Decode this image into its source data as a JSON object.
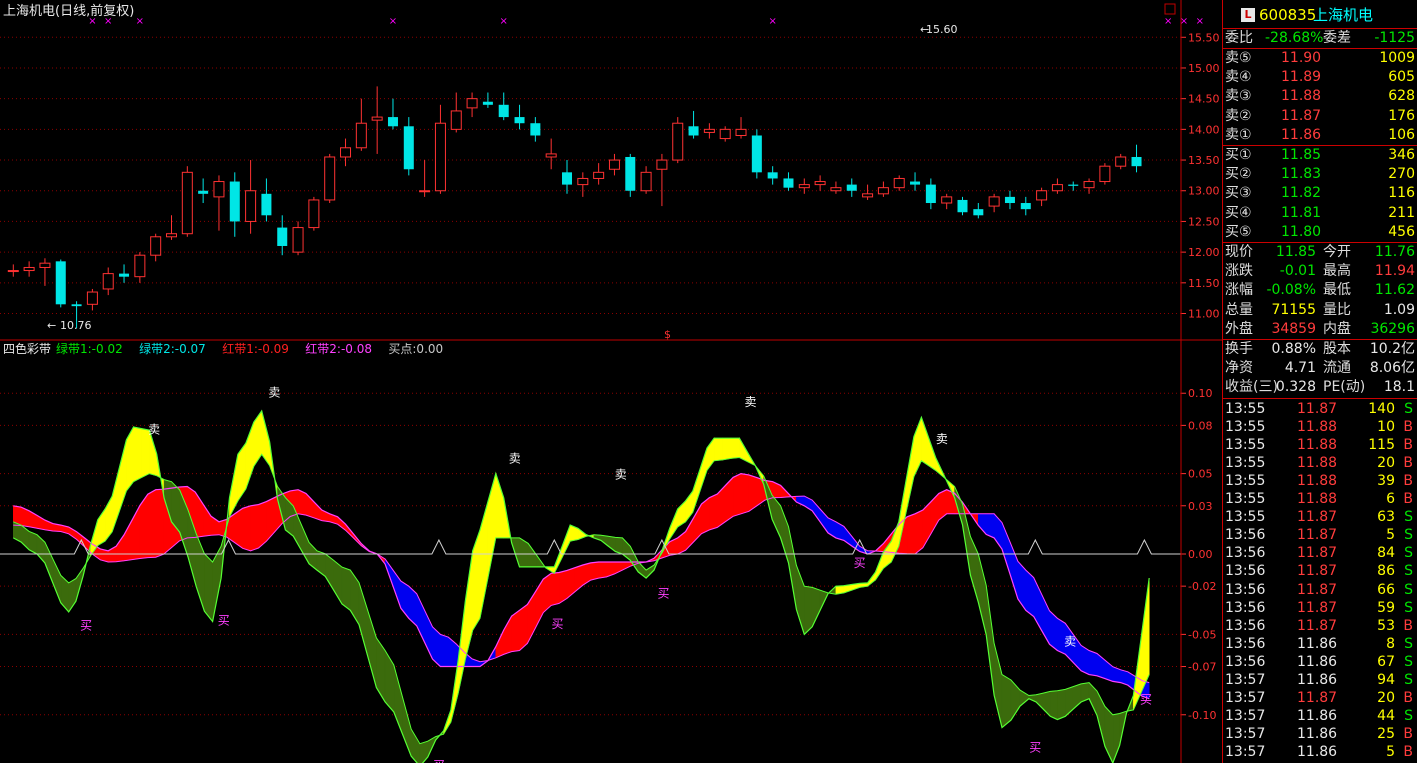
{
  "window": {
    "title": "上海机电(日线,前复权)",
    "peak_label": "15.60",
    "trough_label": "10.76",
    "dollar_marker": "$"
  },
  "indicator": {
    "name": "四色彩带",
    "legend": [
      {
        "text": "绿带1:-0.02",
        "color": "#00e600"
      },
      {
        "text": "绿带2:-0.07",
        "color": "#00e6e6"
      },
      {
        "text": "红带1:-0.09",
        "color": "#ff2020"
      },
      {
        "text": "红带2:-0.08",
        "color": "#ff40ff"
      },
      {
        "text": "买点:0.00",
        "color": "#c8c8c8"
      }
    ],
    "sell_label": "卖",
    "buy_label": "买"
  },
  "colors": {
    "up": "#ff3232",
    "down": "#00e6e6",
    "grid": "#8b0000",
    "axis": "#ff3232",
    "marker": "#ff00ff",
    "yellow_band": "#ffff00",
    "green_band": "#3b6b0c",
    "red_band": "#ff0000",
    "blue_band": "#0000f0"
  },
  "chart_data": [
    {
      "type": "candlestick",
      "ylim": [
        10.65,
        15.7
      ],
      "y_ticks": [
        "15.50",
        "15.00",
        "14.50",
        "14.00",
        "13.50",
        "13.00",
        "12.50",
        "12.00",
        "11.50",
        "11.00"
      ],
      "tick_values": [
        15.5,
        15.0,
        14.5,
        14.0,
        13.5,
        13.0,
        12.5,
        12.0,
        11.5,
        11.0
      ],
      "ohlc": [
        [
          11.7,
          11.8,
          11.6,
          11.7
        ],
        [
          11.7,
          11.85,
          11.6,
          11.75
        ],
        [
          11.75,
          11.9,
          11.45,
          11.82
        ],
        [
          11.85,
          11.88,
          11.1,
          11.15
        ],
        [
          11.15,
          11.2,
          10.76,
          11.12
        ],
        [
          11.15,
          11.4,
          11.05,
          11.35
        ],
        [
          11.4,
          11.75,
          11.3,
          11.65
        ],
        [
          11.65,
          11.8,
          11.5,
          11.6
        ],
        [
          11.6,
          12.0,
          11.5,
          11.95
        ],
        [
          11.95,
          12.3,
          11.85,
          12.25
        ],
        [
          12.25,
          12.6,
          12.2,
          12.3
        ],
        [
          12.3,
          13.4,
          12.25,
          13.3
        ],
        [
          13.0,
          13.2,
          12.8,
          12.95
        ],
        [
          12.9,
          13.25,
          12.35,
          13.15
        ],
        [
          13.15,
          13.3,
          12.25,
          12.5
        ],
        [
          12.5,
          13.5,
          12.3,
          13.0
        ],
        [
          12.95,
          13.2,
          12.5,
          12.6
        ],
        [
          12.4,
          12.6,
          11.95,
          12.1
        ],
        [
          12.0,
          12.5,
          11.95,
          12.4
        ],
        [
          12.4,
          12.9,
          12.35,
          12.85
        ],
        [
          12.85,
          13.6,
          12.8,
          13.55
        ],
        [
          13.55,
          13.85,
          13.4,
          13.7
        ],
        [
          13.7,
          14.5,
          13.65,
          14.1
        ],
        [
          14.15,
          14.7,
          13.6,
          14.2
        ],
        [
          14.2,
          14.5,
          14.0,
          14.05
        ],
        [
          14.05,
          14.2,
          13.25,
          13.35
        ],
        [
          13.0,
          13.5,
          12.9,
          13.0
        ],
        [
          13.0,
          14.4,
          12.95,
          14.1
        ],
        [
          14.0,
          14.6,
          13.95,
          14.3
        ],
        [
          14.35,
          14.6,
          14.2,
          14.5
        ],
        [
          14.45,
          14.6,
          14.35,
          14.4
        ],
        [
          14.4,
          14.6,
          14.15,
          14.2
        ],
        [
          14.2,
          14.4,
          14.0,
          14.1
        ],
        [
          14.1,
          14.2,
          13.8,
          13.9
        ],
        [
          13.55,
          13.85,
          13.35,
          13.6
        ],
        [
          13.3,
          13.5,
          12.95,
          13.1
        ],
        [
          13.1,
          13.3,
          12.9,
          13.2
        ],
        [
          13.2,
          13.45,
          13.1,
          13.3
        ],
        [
          13.35,
          13.6,
          13.25,
          13.5
        ],
        [
          13.55,
          13.6,
          12.9,
          13.0
        ],
        [
          13.0,
          13.4,
          12.95,
          13.3
        ],
        [
          13.35,
          13.6,
          12.75,
          13.5
        ],
        [
          13.5,
          14.2,
          13.45,
          14.1
        ],
        [
          14.05,
          14.3,
          13.85,
          13.9
        ],
        [
          13.95,
          14.1,
          13.85,
          14.0
        ],
        [
          13.85,
          14.05,
          13.8,
          14.0
        ],
        [
          13.9,
          14.2,
          13.85,
          14.0
        ],
        [
          13.9,
          14.0,
          13.2,
          13.3
        ],
        [
          13.3,
          13.4,
          13.1,
          13.2
        ],
        [
          13.2,
          13.3,
          13.0,
          13.05
        ],
        [
          13.05,
          13.2,
          12.95,
          13.1
        ],
        [
          13.1,
          13.25,
          13.0,
          13.15
        ],
        [
          13.0,
          13.15,
          12.95,
          13.05
        ],
        [
          13.1,
          13.2,
          12.9,
          13.0
        ],
        [
          12.9,
          13.1,
          12.85,
          12.95
        ],
        [
          12.95,
          13.15,
          12.9,
          13.05
        ],
        [
          13.05,
          13.25,
          13.0,
          13.2
        ],
        [
          13.15,
          13.3,
          13.0,
          13.1
        ],
        [
          13.1,
          13.2,
          12.7,
          12.8
        ],
        [
          12.8,
          12.95,
          12.7,
          12.9
        ],
        [
          12.85,
          12.9,
          12.6,
          12.65
        ],
        [
          12.7,
          12.8,
          12.55,
          12.6
        ],
        [
          12.75,
          12.95,
          12.65,
          12.9
        ],
        [
          12.9,
          13.0,
          12.7,
          12.8
        ],
        [
          12.8,
          12.9,
          12.6,
          12.7
        ],
        [
          12.85,
          13.05,
          12.75,
          13.0
        ],
        [
          13.0,
          13.2,
          12.95,
          13.1
        ],
        [
          13.1,
          13.15,
          13.0,
          13.08
        ],
        [
          13.05,
          13.2,
          12.95,
          13.15
        ],
        [
          13.15,
          13.45,
          13.1,
          13.4
        ],
        [
          13.4,
          13.6,
          13.35,
          13.55
        ],
        [
          13.55,
          13.75,
          13.3,
          13.4
        ]
      ],
      "markers_top_days": [
        5,
        6,
        8,
        24,
        31,
        48,
        73,
        74,
        75
      ]
    },
    {
      "type": "area",
      "ylim": [
        -0.13,
        0.13
      ],
      "y_ticks": [
        "0.10",
        "0.08",
        "0.05",
        "0.03",
        "0.00",
        "-0.02",
        "-0.05",
        "-0.07",
        "-0.10"
      ],
      "tick_values": [
        0.1,
        0.08,
        0.05,
        0.03,
        0.0,
        -0.02,
        -0.05,
        -0.07,
        -0.1
      ],
      "signals": [
        {
          "kind": "sell",
          "x": 8.9,
          "y": 0.075
        },
        {
          "kind": "sell",
          "x": 16.5,
          "y": 0.098
        },
        {
          "kind": "sell",
          "x": 31.7,
          "y": 0.057
        },
        {
          "kind": "sell",
          "x": 38.4,
          "y": 0.047
        },
        {
          "kind": "sell",
          "x": 46.6,
          "y": 0.092
        },
        {
          "kind": "sell",
          "x": 58.7,
          "y": 0.069
        },
        {
          "kind": "sell",
          "x": 66.8,
          "y": -0.057
        },
        {
          "kind": "buy",
          "x": 4.6,
          "y": -0.047
        },
        {
          "kind": "buy",
          "x": 13.3,
          "y": -0.044
        },
        {
          "kind": "buy",
          "x": 34.4,
          "y": -0.046
        },
        {
          "kind": "buy",
          "x": 41.1,
          "y": -0.027
        },
        {
          "kind": "buy",
          "x": 53.5,
          "y": -0.008
        },
        {
          "kind": "buy",
          "x": 26.9,
          "y": -0.134
        },
        {
          "kind": "buy",
          "x": 64.6,
          "y": -0.123
        },
        {
          "kind": "buy",
          "x": 71.6,
          "y": -0.093
        }
      ]
    }
  ],
  "panel": {
    "code_badge": "L",
    "code": "600835",
    "name": "上海机电",
    "weibi_label": "委比",
    "weibi": "-28.68%",
    "weicha_label": "委差",
    "weicha": "-1125",
    "asks": [
      {
        "label": "卖⑤",
        "price": "11.90",
        "vol": "1009"
      },
      {
        "label": "卖④",
        "price": "11.89",
        "vol": "605"
      },
      {
        "label": "卖③",
        "price": "11.88",
        "vol": "628"
      },
      {
        "label": "卖②",
        "price": "11.87",
        "vol": "176"
      },
      {
        "label": "卖①",
        "price": "11.86",
        "vol": "106"
      }
    ],
    "bids": [
      {
        "label": "买①",
        "price": "11.85",
        "vol": "346"
      },
      {
        "label": "买②",
        "price": "11.83",
        "vol": "270"
      },
      {
        "label": "买③",
        "price": "11.82",
        "vol": "116"
      },
      {
        "label": "买④",
        "price": "11.81",
        "vol": "211"
      },
      {
        "label": "买⑤",
        "price": "11.80",
        "vol": "456"
      }
    ],
    "stats": [
      {
        "l1": "现价",
        "v1": "11.85",
        "c1": "green",
        "l2": "今开",
        "v2": "11.76",
        "c2": "green"
      },
      {
        "l1": "涨跌",
        "v1": "-0.01",
        "c1": "green",
        "l2": "最高",
        "v2": "11.94",
        "c2": "red"
      },
      {
        "l1": "涨幅",
        "v1": "-0.08%",
        "c1": "green",
        "l2": "最低",
        "v2": "11.62",
        "c2": "green"
      },
      {
        "l1": "总量",
        "v1": "71155",
        "c1": "yellow",
        "l2": "量比",
        "v2": "1.09",
        "c2": "white"
      },
      {
        "l1": "外盘",
        "v1": "34859",
        "c1": "red",
        "l2": "内盘",
        "v2": "36296",
        "c2": "green"
      }
    ],
    "stats2": [
      {
        "l1": "换手",
        "v1": "0.88%",
        "l2": "股本",
        "v2": "10.2亿"
      },
      {
        "l1": "净资",
        "v1": "4.71",
        "l2": "流通",
        "v2": "8.06亿"
      },
      {
        "l1": "收益(三)",
        "v1": "0.328",
        "l2": "PE(动)",
        "v2": "18.1"
      }
    ],
    "trades": [
      {
        "t": "13:55",
        "p": "11.87",
        "pc": "red",
        "v": "140",
        "s": "S"
      },
      {
        "t": "13:55",
        "p": "11.88",
        "pc": "red",
        "v": "10",
        "s": "B"
      },
      {
        "t": "13:55",
        "p": "11.88",
        "pc": "red",
        "v": "115",
        "s": "B"
      },
      {
        "t": "13:55",
        "p": "11.88",
        "pc": "red",
        "v": "20",
        "s": "B"
      },
      {
        "t": "13:55",
        "p": "11.88",
        "pc": "red",
        "v": "39",
        "s": "B"
      },
      {
        "t": "13:55",
        "p": "11.88",
        "pc": "red",
        "v": "6",
        "s": "B"
      },
      {
        "t": "13:55",
        "p": "11.87",
        "pc": "red",
        "v": "63",
        "s": "S"
      },
      {
        "t": "13:56",
        "p": "11.87",
        "pc": "red",
        "v": "5",
        "s": "S"
      },
      {
        "t": "13:56",
        "p": "11.87",
        "pc": "red",
        "v": "84",
        "s": "S"
      },
      {
        "t": "13:56",
        "p": "11.87",
        "pc": "red",
        "v": "86",
        "s": "S"
      },
      {
        "t": "13:56",
        "p": "11.87",
        "pc": "red",
        "v": "66",
        "s": "S"
      },
      {
        "t": "13:56",
        "p": "11.87",
        "pc": "red",
        "v": "59",
        "s": "S"
      },
      {
        "t": "13:56",
        "p": "11.87",
        "pc": "red",
        "v": "53",
        "s": "B"
      },
      {
        "t": "13:56",
        "p": "11.86",
        "pc": "white",
        "v": "8",
        "s": "S"
      },
      {
        "t": "13:56",
        "p": "11.86",
        "pc": "white",
        "v": "67",
        "s": "S"
      },
      {
        "t": "13:57",
        "p": "11.86",
        "pc": "white",
        "v": "94",
        "s": "S"
      },
      {
        "t": "13:57",
        "p": "11.87",
        "pc": "red",
        "v": "20",
        "s": "B"
      },
      {
        "t": "13:57",
        "p": "11.86",
        "pc": "white",
        "v": "44",
        "s": "S"
      },
      {
        "t": "13:57",
        "p": "11.86",
        "pc": "white",
        "v": "25",
        "s": "B"
      },
      {
        "t": "13:57",
        "p": "11.86",
        "pc": "white",
        "v": "5",
        "s": "B"
      }
    ]
  }
}
